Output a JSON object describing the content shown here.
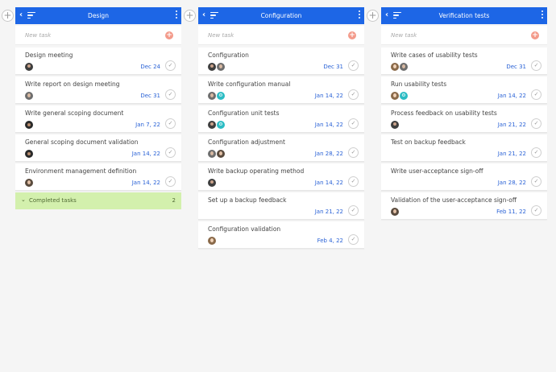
{
  "new_task_placeholder": "New task",
  "columns": [
    {
      "title": "Design",
      "cards": [
        {
          "title": "Design meeting",
          "date": "Dec 24",
          "avatars": [
            "a1"
          ]
        },
        {
          "title": "Write report on design meeting",
          "date": "Dec 31",
          "avatars": [
            "a2"
          ]
        },
        {
          "title": "Write general scoping document",
          "date": "Jan 7, 22",
          "avatars": [
            "a3"
          ]
        },
        {
          "title": "General scoping document validation",
          "date": "Jan 14, 22",
          "avatars": [
            "a3"
          ]
        },
        {
          "title": "Environment management definition",
          "date": "Jan 14, 22",
          "avatars": [
            "a4"
          ]
        }
      ],
      "completed": {
        "label": "Completed tasks",
        "count": "2"
      }
    },
    {
      "title": "Configuration",
      "cards": [
        {
          "title": "Configuration",
          "date": "Dec 31",
          "avatars": [
            "a1",
            "a2"
          ]
        },
        {
          "title": "Write configuration manual",
          "date": "Jan 14, 22",
          "avatars": [
            "a2",
            "teal"
          ]
        },
        {
          "title": "Configuration unit tests",
          "date": "Jan 14, 22",
          "avatars": [
            "a1",
            "teal"
          ]
        },
        {
          "title": "Configuration adjustment",
          "date": "Jan 28, 22",
          "avatars": [
            "a2",
            "a4"
          ]
        },
        {
          "title": "Write backup operating method",
          "date": "Jan 14, 22",
          "avatars": [
            "a1"
          ]
        },
        {
          "title": "Set up a backup feedback",
          "date": "Jan 21, 22",
          "avatars": []
        },
        {
          "title": "Configuration validation",
          "date": "Feb 4, 22",
          "avatars": [
            "a5"
          ]
        }
      ]
    },
    {
      "title": "Verification tests",
      "cards": [
        {
          "title": "Write cases of usability tests",
          "date": "Dec 31",
          "avatars": [
            "a5",
            "a2"
          ]
        },
        {
          "title": "Run usability tests",
          "date": "Jan 14, 22",
          "avatars": [
            "a5",
            "teal"
          ]
        },
        {
          "title": "Process feedback on usability tests",
          "date": "Jan 21, 22",
          "avatars": [
            "a1"
          ]
        },
        {
          "title": "Test on backup feedback",
          "date": "Jan 21, 22",
          "avatars": []
        },
        {
          "title": "Write user-acceptance sign-off",
          "date": "Jan 28, 22",
          "avatars": []
        },
        {
          "title": "Validation of the user-acceptance sign-off",
          "date": "Feb 11, 22",
          "avatars": [
            "a4"
          ]
        }
      ]
    }
  ],
  "colors": {
    "header": "#1d66e6",
    "date": "#2a62d6",
    "completed_bg": "#d3f0ad",
    "add_icon": "#f39a8a"
  },
  "icons": {
    "back": "chevron-left-icon",
    "sort": "sort-icon",
    "more": "more-vertical-icon",
    "add": "plus-icon",
    "check": "check-icon",
    "expand": "chevron-down-icon"
  }
}
